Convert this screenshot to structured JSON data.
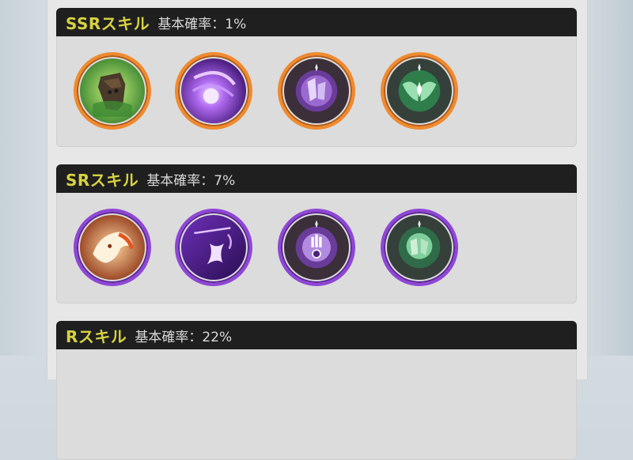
{
  "sections": [
    {
      "rarity": "SSRスキル",
      "rate": "基本確率：1%",
      "ring": "orange",
      "skills": [
        {
          "icon": "green-tree-stump-icon"
        },
        {
          "icon": "purple-vortex-icon"
        },
        {
          "icon": "purple-crystal-shards-icon"
        },
        {
          "icon": "green-winged-emblem-icon"
        }
      ]
    },
    {
      "rarity": "SRスキル",
      "rate": "基本確率：7%",
      "ring": "purple",
      "skills": [
        {
          "icon": "fire-lion-icon"
        },
        {
          "icon": "purple-diamond-sigil-icon"
        },
        {
          "icon": "purple-ornate-emblem-icon"
        },
        {
          "icon": "green-cracked-stone-icon"
        }
      ]
    },
    {
      "rarity": "Rスキル",
      "rate": "基本確率：22%"
    }
  ],
  "colors": {
    "rarity_text": "#d6d342",
    "ring_orange": "#f08a2e",
    "ring_purple": "#8e46d6",
    "header_bg": "#1f1f1f"
  }
}
